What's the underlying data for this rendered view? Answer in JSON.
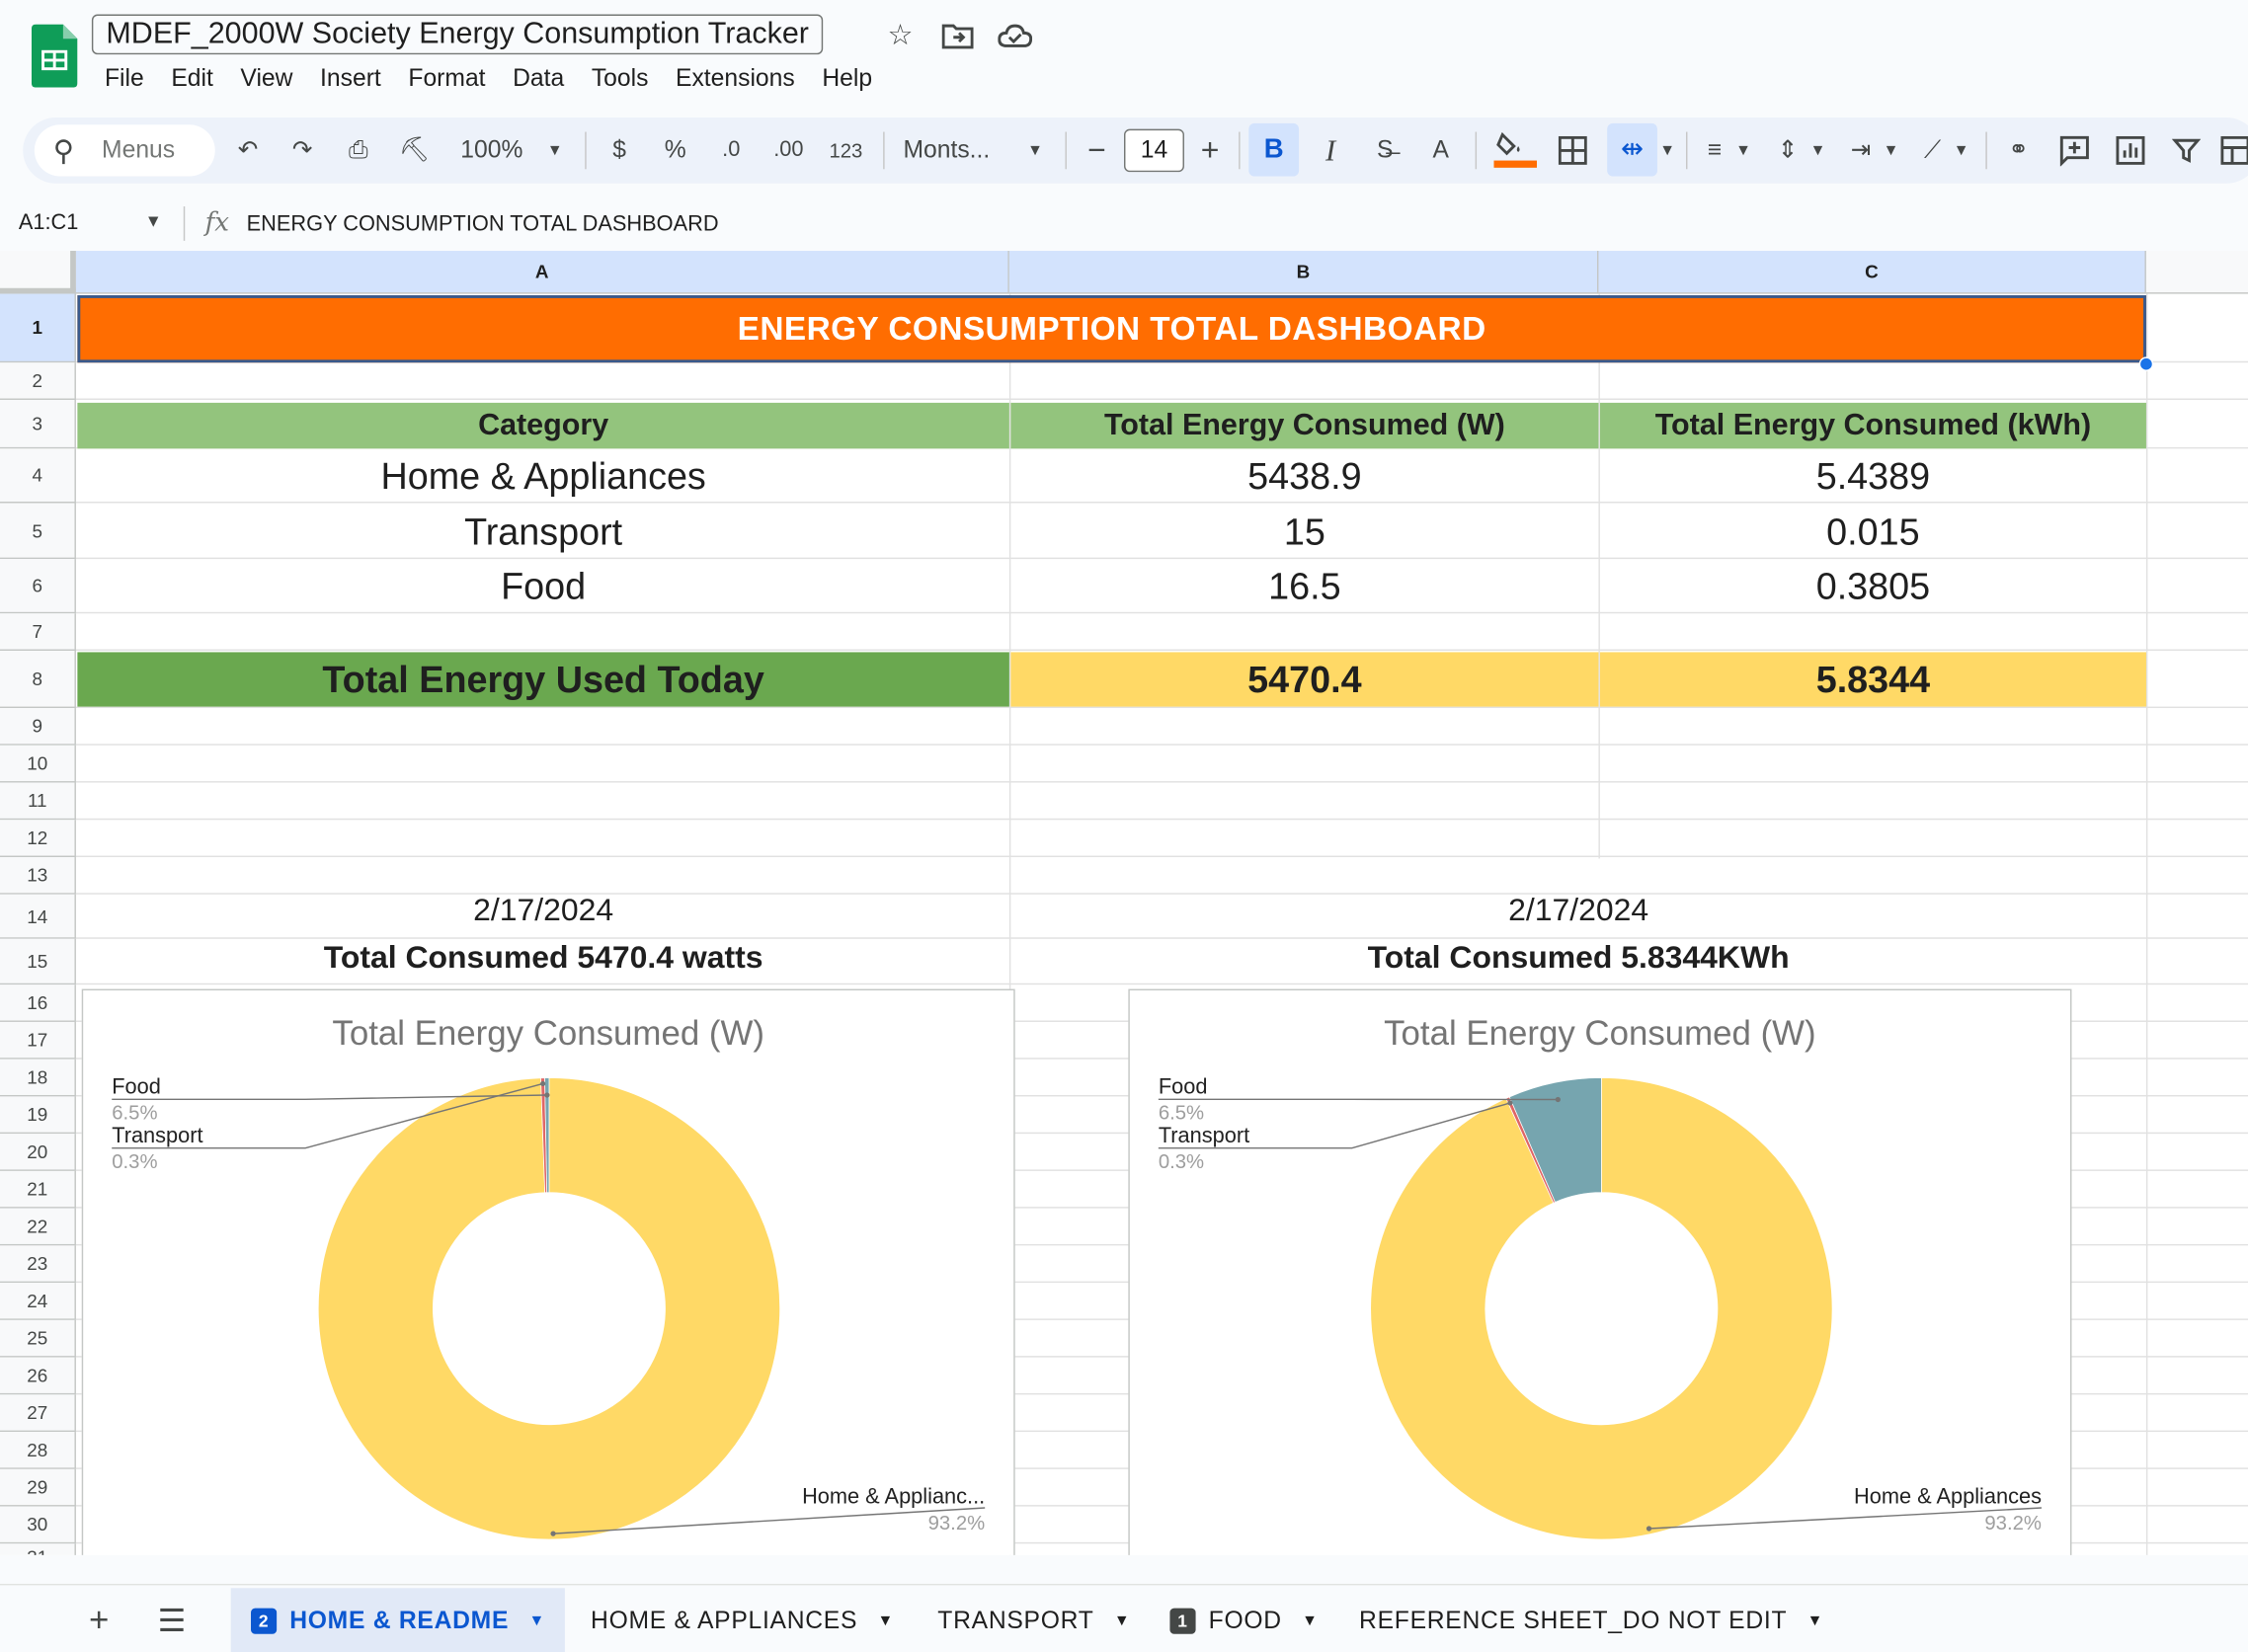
{
  "app": {
    "doc_title": "MDEF_2000W Society Energy Consumption Tracker",
    "menus": [
      "File",
      "Edit",
      "View",
      "Insert",
      "Format",
      "Data",
      "Tools",
      "Extensions",
      "Help"
    ]
  },
  "toolbar": {
    "search_placeholder": "Menus",
    "zoom": "100%",
    "currency": "$",
    "percent": "%",
    "dec_decrease": ".0",
    "dec_increase": ".00",
    "number_format": "123",
    "font": "Monts...",
    "font_size": "14",
    "bold": "B",
    "italic": "I",
    "text_color": "A",
    "fill_color": "#ff6d01"
  },
  "formula_bar": {
    "name_box": "A1:C1",
    "fx": "fx",
    "content": "ENERGY CONSUMPTION TOTAL DASHBOARD"
  },
  "grid": {
    "columns": [
      "A",
      "B",
      "C"
    ],
    "rows": [
      "1",
      "2",
      "3",
      "4",
      "5",
      "6",
      "7",
      "8",
      "9",
      "10",
      "11",
      "12",
      "13",
      "14",
      "15",
      "16",
      "17",
      "18",
      "19",
      "20",
      "21",
      "22",
      "23",
      "24",
      "25",
      "26",
      "27",
      "28",
      "29",
      "30",
      "31"
    ],
    "banner": "ENERGY CONSUMPTION TOTAL DASHBOARD",
    "table_headers": [
      "Category",
      "Total Energy Consumed (W)",
      "Total Energy Consumed (kWh)"
    ],
    "table_rows": [
      [
        "Home & Appliances",
        "5438.9",
        "5.4389"
      ],
      [
        "Transport",
        "15",
        "0.015"
      ],
      [
        "Food",
        "16.5",
        "0.3805"
      ]
    ],
    "total": [
      "Total Energy Used Today",
      "5470.4",
      "5.8344"
    ],
    "left_date": "2/17/2024",
    "left_total": "Total Consumed 5470.4 watts",
    "right_date": "2/17/2024",
    "right_total": "Total Consumed 5.8344KWh"
  },
  "chart_data": [
    {
      "type": "pie",
      "donut": true,
      "title": "Total Energy Consumed (W)",
      "categories": [
        "Home & Appliances",
        "Transport",
        "Food"
      ],
      "values": [
        5438.9,
        15,
        16.5
      ],
      "percent_labels": [
        "93.2%",
        "0.3%",
        "6.5%"
      ],
      "slice_label_texts": [
        "Home & Applianc...",
        "Transport",
        "Food"
      ],
      "colors": [
        "#ffd966",
        "#e06666",
        "#76a5af"
      ]
    },
    {
      "type": "pie",
      "donut": true,
      "title": "Total Energy Consumed (W)",
      "categories": [
        "Home & Appliances",
        "Transport",
        "Food"
      ],
      "values": [
        5.4389,
        0.015,
        0.3805
      ],
      "percent_labels": [
        "93.2%",
        "0.3%",
        "6.5%"
      ],
      "slice_label_texts": [
        "Home & Appliances",
        "Transport",
        "Food"
      ],
      "colors": [
        "#ffd966",
        "#e06666",
        "#76a5af"
      ]
    }
  ],
  "sheets": [
    {
      "label": "HOME & README",
      "badge": "2",
      "active": true
    },
    {
      "label": "HOME & APPLIANCES",
      "badge": "",
      "active": false
    },
    {
      "label": "TRANSPORT",
      "badge": "",
      "active": false
    },
    {
      "label": "FOOD",
      "badge": "1",
      "active": false
    },
    {
      "label": "REFERENCE SHEET_DO NOT EDIT",
      "badge": "",
      "active": false
    }
  ],
  "colors": {
    "banner": "#ff6d01",
    "header_green": "#93c47d",
    "total_green": "#6aa84f",
    "total_yellow": "#ffd966",
    "accent_blue": "#0b57d0"
  }
}
